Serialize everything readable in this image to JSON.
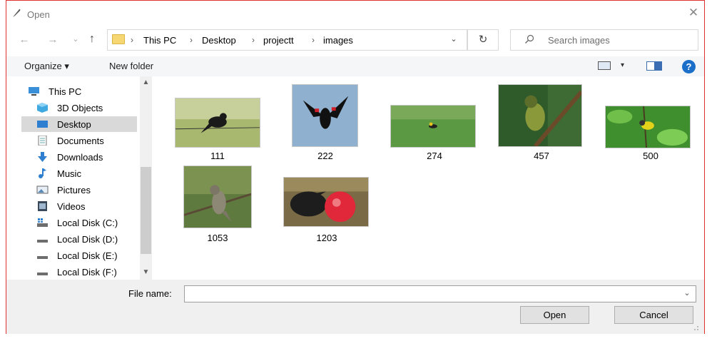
{
  "window": {
    "title": "Open",
    "close_glyph": "✕"
  },
  "nav_buttons": {
    "back_glyph": "←",
    "forward_glyph": "→",
    "recent_glyph": "⌄",
    "up_glyph": "↑"
  },
  "address": {
    "breadcrumbs": [
      "This PC",
      "Desktop",
      "projectt",
      "images"
    ],
    "separator": "›",
    "dropdown_glyph": "⌄",
    "refresh_glyph": "↻"
  },
  "search": {
    "placeholder": "Search images"
  },
  "toolbar": {
    "organize_label": "Organize ▾",
    "new_folder_label": "New folder",
    "view_dropdown_glyph": "▾",
    "help_label": "?"
  },
  "nav_pane": {
    "items": [
      {
        "label": "This PC",
        "icon": "computer-icon"
      },
      {
        "label": "3D Objects",
        "icon": "cube-icon"
      },
      {
        "label": "Desktop",
        "icon": "desktop-icon",
        "selected": true
      },
      {
        "label": "Documents",
        "icon": "documents-icon"
      },
      {
        "label": "Downloads",
        "icon": "download-arrow-icon"
      },
      {
        "label": "Music",
        "icon": "music-note-icon"
      },
      {
        "label": "Pictures",
        "icon": "pictures-icon"
      },
      {
        "label": "Videos",
        "icon": "videos-icon"
      },
      {
        "label": "Local Disk (C:)",
        "icon": "system-drive-icon"
      },
      {
        "label": "Local Disk (D:)",
        "icon": "drive-icon"
      },
      {
        "label": "Local Disk (E:)",
        "icon": "drive-icon"
      },
      {
        "label": "Local Disk (F:)",
        "icon": "drive-icon"
      }
    ],
    "scroll_up_glyph": "▲",
    "scroll_down_glyph": "▼"
  },
  "files": [
    {
      "name": "111",
      "subject": "black bird on wire"
    },
    {
      "name": "222",
      "subject": "red-winged blackbird in flight"
    },
    {
      "name": "274",
      "subject": "yellow-headed bird on grass"
    },
    {
      "name": "457",
      "subject": "speckled bird on branch"
    },
    {
      "name": "500",
      "subject": "warbler in foliage"
    },
    {
      "name": "1053",
      "subject": "flycatcher on twig"
    },
    {
      "name": "1203",
      "subject": "frigatebird with red pouch"
    }
  ],
  "footer": {
    "file_name_label": "File name:",
    "file_name_value": "",
    "open_label": "Open",
    "cancel_label": "Cancel",
    "dropdown_glyph": "⌄"
  },
  "colors": {
    "selection": "#cce8ff",
    "help_blue": "#1b6fc9",
    "folder_yellow": "#f7d774"
  }
}
